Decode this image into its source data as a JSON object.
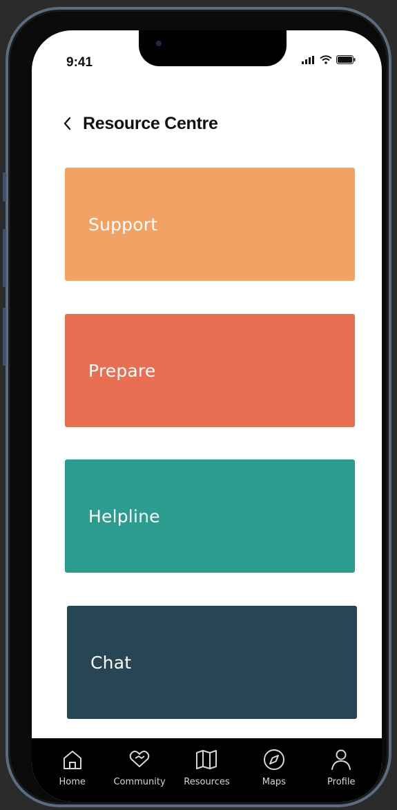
{
  "status_bar": {
    "time": "9:41"
  },
  "header": {
    "title": "Resource Centre"
  },
  "cards": [
    {
      "label": "Support",
      "color": "#f2a262"
    },
    {
      "label": "Prepare",
      "color": "#e86f52"
    },
    {
      "label": "Helpline",
      "color": "#2a9d8f"
    },
    {
      "label": "Chat",
      "color": "#264653"
    }
  ],
  "tabbar": {
    "items": [
      {
        "label": "Home",
        "icon": "home-icon"
      },
      {
        "label": "Community",
        "icon": "community-icon"
      },
      {
        "label": "Resources",
        "icon": "map-icon"
      },
      {
        "label": "Maps",
        "icon": "compass-icon"
      },
      {
        "label": "Profile",
        "icon": "profile-icon"
      }
    ]
  },
  "colors": {
    "background": "#ffffff",
    "tabbar": "#000000",
    "frame": "#5a6d80"
  }
}
